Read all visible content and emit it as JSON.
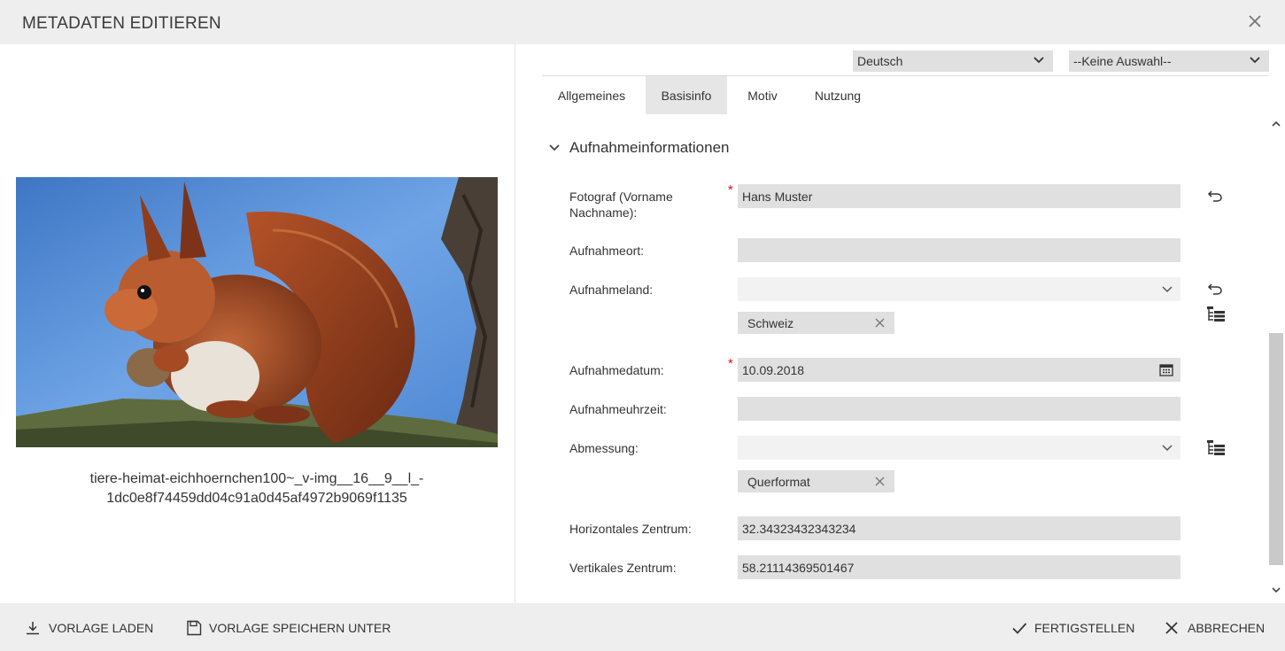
{
  "dialog": {
    "title": "METADATEN EDITIEREN",
    "close_icon": "close-icon"
  },
  "preview": {
    "filename": "tiere-heimat-eichhoernchen100~_v-img__16__9__l_-1dc0e8f74459dd04c91a0d45af4972b9069f1135",
    "filename_line1": "tiere-heimat-eichhoernchen100~_v-img__16__9__l_-",
    "filename_line2": "1dc0e8f74459dd04c91a0d45af4972b9069f1135"
  },
  "language_select": {
    "value": "Deutsch"
  },
  "secondary_select": {
    "value": "--Keine Auswahl--"
  },
  "tabs": [
    {
      "label": "Allgemeines",
      "active": false
    },
    {
      "label": "Basisinfo",
      "active": true
    },
    {
      "label": "Motiv",
      "active": false
    },
    {
      "label": "Nutzung",
      "active": false
    }
  ],
  "section": {
    "title": "Aufnahmeinformationen",
    "expanded": true
  },
  "fields": {
    "fotograf": {
      "label": "Fotograf (Vorname Nachname):",
      "value": "Hans Muster",
      "required": true
    },
    "aufnahmeort": {
      "label": "Aufnahmeort:",
      "value": ""
    },
    "aufnahmeland": {
      "label": "Aufnahmeland:",
      "value": "",
      "chip": "Schweiz"
    },
    "aufnahmedatum": {
      "label": "Aufnahmedatum:",
      "value": "10.09.2018",
      "required": true
    },
    "aufnahmeuhrzeit": {
      "label": "Aufnahmeuhrzeit:",
      "value": ""
    },
    "abmessung": {
      "label": "Abmessung:",
      "value": "",
      "chip": "Querformat"
    },
    "horizontales_zentrum": {
      "label": "Horizontales Zentrum:",
      "value": "32.34323432343234"
    },
    "vertikales_zentrum": {
      "label": "Vertikales Zentrum:",
      "value": "58.21114369501467"
    }
  },
  "required_marker": "*",
  "footer": {
    "load_template": "VORLAGE LADEN",
    "save_template_as": "VORLAGE SPEICHERN UNTER",
    "finish": "FERTIGSTELLEN",
    "cancel": "ABBRECHEN"
  },
  "colors": {
    "header_bg": "#eeeeee",
    "field_bg": "#e0e0e0",
    "required": "#dd1111",
    "active_tab_bg": "#e6e6e6"
  }
}
